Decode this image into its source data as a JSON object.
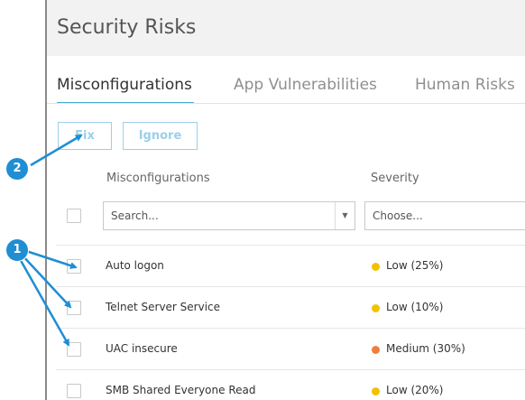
{
  "page": {
    "title": "Security Risks"
  },
  "tabs": [
    {
      "label": "Misconfigurations",
      "active": true
    },
    {
      "label": "App Vulnerabilities",
      "active": false
    },
    {
      "label": "Human Risks",
      "active": false
    }
  ],
  "toolbar": {
    "fix_label": "Fix",
    "ignore_label": "Ignore"
  },
  "table": {
    "columns": [
      "Misconfigurations",
      "Severity"
    ],
    "filters": {
      "name_placeholder": "Search...",
      "severity_placeholder": "Choose..."
    },
    "rows": [
      {
        "name": "Auto logon",
        "severity": "Low (25%)",
        "severity_level": "low"
      },
      {
        "name": "Telnet Server Service",
        "severity": "Low (10%)",
        "severity_level": "low"
      },
      {
        "name": "UAC insecure",
        "severity": "Medium (30%)",
        "severity_level": "medium"
      },
      {
        "name": "SMB Shared Everyone Read",
        "severity": "Low (20%)",
        "severity_level": "low"
      }
    ]
  },
  "callouts": [
    "1",
    "2"
  ],
  "colors": {
    "accent": "#4aa8d8",
    "callout": "#1f8ed3",
    "severity_low": "#f2c200",
    "severity_medium": "#f07d3c"
  }
}
